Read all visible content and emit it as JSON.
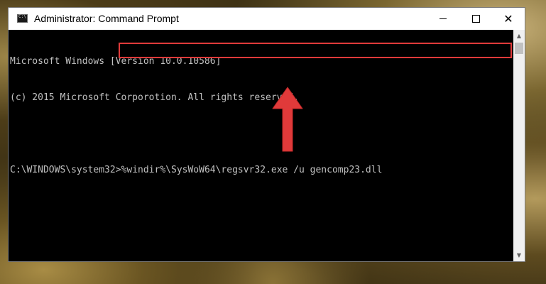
{
  "window": {
    "title": "Administrator: Command Prompt",
    "controls": {
      "minimize": "minimize",
      "maximize": "maximize",
      "close": "✕"
    }
  },
  "console": {
    "lines": [
      "Microsoft Windows [Version 10.0.10586]",
      "(c) 2015 Microsoft Corporotion. All rights reserved."
    ],
    "prompt": "C:\\WINDOWS\\system32>",
    "command": "%windir%\\SysWoW64\\regsvr32.exe /u gencomp23.dll"
  },
  "annotation": {
    "highlight_color": "#e03a3a",
    "arrow_color": "#e03a3a"
  },
  "icons": {
    "app": "cmd-icon",
    "scroll_up": "scroll-up-icon",
    "scroll_down": "scroll-down-icon"
  }
}
